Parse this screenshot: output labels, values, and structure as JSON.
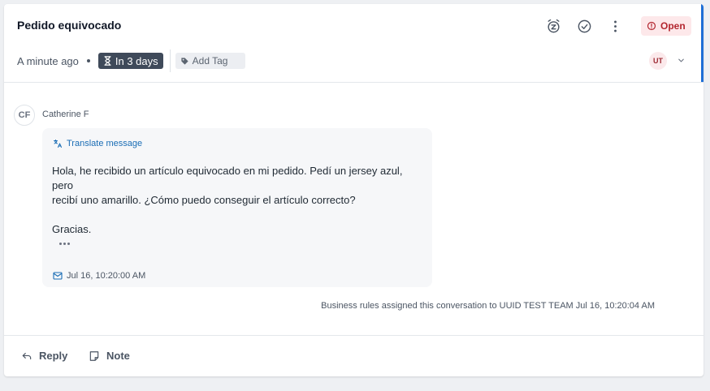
{
  "colors": {
    "accent": "#1f6fd6",
    "status_bg": "#fde8ea",
    "status_text": "#b3262f",
    "sla_bg": "#3f4a5a",
    "link": "#1a6db5"
  },
  "header": {
    "title": "Pedido equivocado",
    "icons": [
      "snooze-icon",
      "resolve-check-icon",
      "more-vertical-icon"
    ],
    "status": {
      "label": "Open",
      "icon": "alert-circle-icon"
    },
    "time_ago": "A minute ago",
    "sla": {
      "label": "In 3 days",
      "icon": "hourglass-icon"
    },
    "tag": {
      "label": "Add Tag",
      "icon": "tag-icon"
    },
    "assignee": {
      "initials": "UT"
    }
  },
  "message": {
    "sender": {
      "initials": "CF",
      "name": "Catherine F"
    },
    "translate_label": "Translate message",
    "lines": [
      "Hola, he recibido un artículo equivocado en mi pedido. Pedí un jersey azul,",
      "pero",
      "recibí uno amarillo. ¿Cómo puedo conseguir el artículo correcto?",
      "Gracias."
    ],
    "timestamp": "Jul 16, 10:20:00 AM"
  },
  "activity": "Business rules assigned this conversation to UUID TEST TEAM Jul 16, 10:20:04 AM",
  "footer": {
    "reply_label": "Reply",
    "note_label": "Note"
  }
}
